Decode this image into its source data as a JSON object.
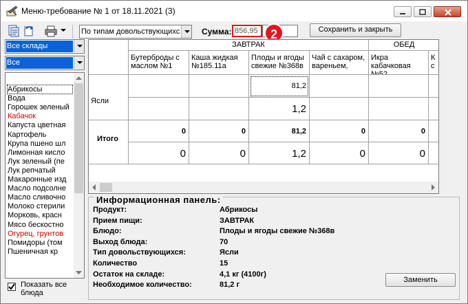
{
  "window": {
    "title": "Меню-требование № 1 от 18.11.2021 (3)"
  },
  "toolbar": {
    "filter_select": "По типам довольствующихся",
    "sum_label": "Сумма:",
    "sum_value": "856,95",
    "badge": "2",
    "save_close": "Сохранить и закрыть"
  },
  "left": {
    "warehouse_select": "Все склады",
    "category_select": "Все",
    "products": [
      {
        "name": "Абрикосы",
        "red": false
      },
      {
        "name": "Вода",
        "red": false
      },
      {
        "name": "Горошек зеленый",
        "red": false
      },
      {
        "name": "Кабачок",
        "red": true
      },
      {
        "name": "Капуста цветная",
        "red": false
      },
      {
        "name": "Картофель",
        "red": false
      },
      {
        "name": "Крупа пшено шл",
        "red": false
      },
      {
        "name": "Лимонная кисло",
        "red": false
      },
      {
        "name": "Лук зеленый (пе",
        "red": false
      },
      {
        "name": "Лук репчатый",
        "red": false
      },
      {
        "name": "Макаронные изд",
        "red": false
      },
      {
        "name": "Масло подсолне",
        "red": false
      },
      {
        "name": "Масло сливочно",
        "red": false
      },
      {
        "name": "Молоко стерили",
        "red": false
      },
      {
        "name": "Морковь, красн",
        "red": false
      },
      {
        "name": "Мясо бескостно",
        "red": false
      },
      {
        "name": "Огурец, грунтов",
        "red": true
      },
      {
        "name": "Помидоры (том",
        "red": false
      },
      {
        "name": "Пшеничная кр",
        "red": false
      }
    ],
    "show_all_label": "Показать все блюда"
  },
  "grid": {
    "meal_headers": [
      "ЗАВТРАК",
      "ОБЕД"
    ],
    "dish_headers": [
      "Бутерброды с маслом №1",
      "Каша жидкая №185.11а",
      "Плоды и ягоды свежие №368в",
      "Чай с сахаром, вареньем,",
      "Икра кабачковая №52",
      "К с"
    ],
    "rows": [
      {
        "label": "Ясли",
        "top": [
          "",
          "",
          "81,2",
          "",
          "",
          ""
        ],
        "bottom": [
          "",
          "",
          "1,2",
          "",
          "",
          ""
        ]
      },
      {
        "label": "Итого",
        "top": [
          "0",
          "0",
          "81,2",
          "0",
          "0",
          ""
        ],
        "bottom": [
          "0",
          "0",
          "1,2",
          "0",
          "0",
          ""
        ]
      }
    ]
  },
  "info": {
    "title": "Информационная панель:",
    "rows": [
      {
        "label": "Продукт:",
        "value": "Абрикосы"
      },
      {
        "label": "Прием пищи:",
        "value": "ЗАВТРАК"
      },
      {
        "label": "Блюдо:",
        "value": "Плоды и ягоды свежие №368в"
      },
      {
        "label": "Выход блюда:",
        "value": "70"
      },
      {
        "label": "Тип довольствующихся:",
        "value": "Ясли"
      },
      {
        "label": "Количество",
        "value": "15"
      },
      {
        "label": "Остаток на складе:",
        "value": "4,1 кг (4100г)"
      },
      {
        "label": "Необходимое количество:",
        "value": "81,2 г"
      }
    ],
    "replace_button": "Заменить"
  }
}
